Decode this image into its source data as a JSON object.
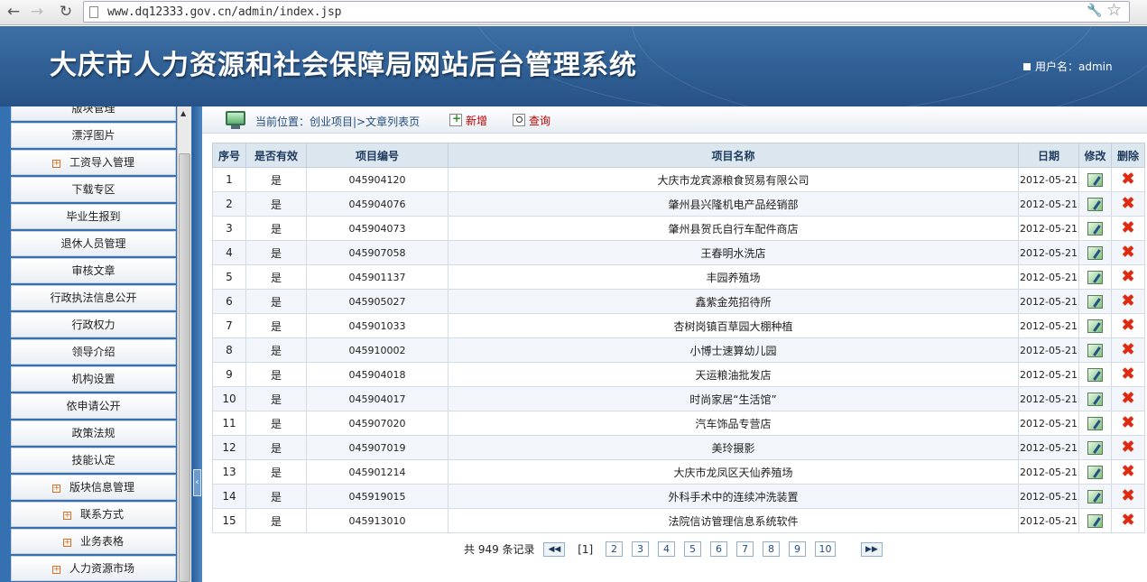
{
  "browser": {
    "url": "www.dq12333.gov.cn/admin/index.jsp"
  },
  "header": {
    "title": "大庆市人力资源和社会保障局网站后台管理系统",
    "user_label": "用户名：admin"
  },
  "sidebar": {
    "items": [
      {
        "label": "版块管理",
        "expand": false
      },
      {
        "label": "漂浮图片",
        "expand": false
      },
      {
        "label": "工资导入管理",
        "expand": true
      },
      {
        "label": "下载专区",
        "expand": false
      },
      {
        "label": "毕业生报到",
        "expand": false
      },
      {
        "label": "退休人员管理",
        "expand": false
      },
      {
        "label": "审核文章",
        "expand": false
      },
      {
        "label": "行政执法信息公开",
        "expand": false
      },
      {
        "label": "行政权力",
        "expand": false
      },
      {
        "label": "领导介绍",
        "expand": false
      },
      {
        "label": "机构设置",
        "expand": false
      },
      {
        "label": "依申请公开",
        "expand": false
      },
      {
        "label": "政策法规",
        "expand": false
      },
      {
        "label": "技能认定",
        "expand": false
      },
      {
        "label": "版块信息管理",
        "expand": true
      },
      {
        "label": "联系方式",
        "expand": true
      },
      {
        "label": "业务表格",
        "expand": true
      },
      {
        "label": "人力资源市场",
        "expand": true
      }
    ]
  },
  "toolbar": {
    "location_prefix": "当前位置：",
    "location_path": "创业项目|>文章列表页",
    "new_label": "新增",
    "query_label": "查询"
  },
  "table": {
    "headers": [
      "序号",
      "是否有效",
      "项目编号",
      "项目名称",
      "日期",
      "修改",
      "删除"
    ],
    "rows": [
      {
        "no": "1",
        "valid": "是",
        "code": "045904120",
        "name": "大庆市龙宾源粮食贸易有限公司",
        "date": "2012-05-21"
      },
      {
        "no": "2",
        "valid": "是",
        "code": "045904076",
        "name": "肇州县兴隆机电产品经销部",
        "date": "2012-05-21"
      },
      {
        "no": "3",
        "valid": "是",
        "code": "045904073",
        "name": "肇州县贺氏自行车配件商店",
        "date": "2012-05-21"
      },
      {
        "no": "4",
        "valid": "是",
        "code": "045907058",
        "name": "王春明水洗店",
        "date": "2012-05-21"
      },
      {
        "no": "5",
        "valid": "是",
        "code": "045901137",
        "name": "丰园养殖场",
        "date": "2012-05-21"
      },
      {
        "no": "6",
        "valid": "是",
        "code": "045905027",
        "name": "鑫紫金苑招待所",
        "date": "2012-05-21"
      },
      {
        "no": "7",
        "valid": "是",
        "code": "045901033",
        "name": "杏树岗镇百草园大棚种植",
        "date": "2012-05-21"
      },
      {
        "no": "8",
        "valid": "是",
        "code": "045910002",
        "name": "小博士速算幼儿园",
        "date": "2012-05-21"
      },
      {
        "no": "9",
        "valid": "是",
        "code": "045904018",
        "name": "天运粮油批发店",
        "date": "2012-05-21"
      },
      {
        "no": "10",
        "valid": "是",
        "code": "045904017",
        "name": "时尚家居“生活馆”",
        "date": "2012-05-21"
      },
      {
        "no": "11",
        "valid": "是",
        "code": "045907020",
        "name": "汽车饰品专营店",
        "date": "2012-05-21"
      },
      {
        "no": "12",
        "valid": "是",
        "code": "045907019",
        "name": "美玲摄影",
        "date": "2012-05-21"
      },
      {
        "no": "13",
        "valid": "是",
        "code": "045901214",
        "name": "大庆市龙凤区天仙养殖场",
        "date": "2012-05-21"
      },
      {
        "no": "14",
        "valid": "是",
        "code": "045919015",
        "name": "外科手术中的连续冲洗装置",
        "date": "2012-05-21"
      },
      {
        "no": "15",
        "valid": "是",
        "code": "045913010",
        "name": "法院信访管理信息系统软件",
        "date": "2012-05-21"
      }
    ]
  },
  "pager": {
    "total_text": "共 949 条记录",
    "current_page": "[1]",
    "pages": [
      "2",
      "3",
      "4",
      "5",
      "6",
      "7",
      "8",
      "9",
      "10"
    ]
  }
}
